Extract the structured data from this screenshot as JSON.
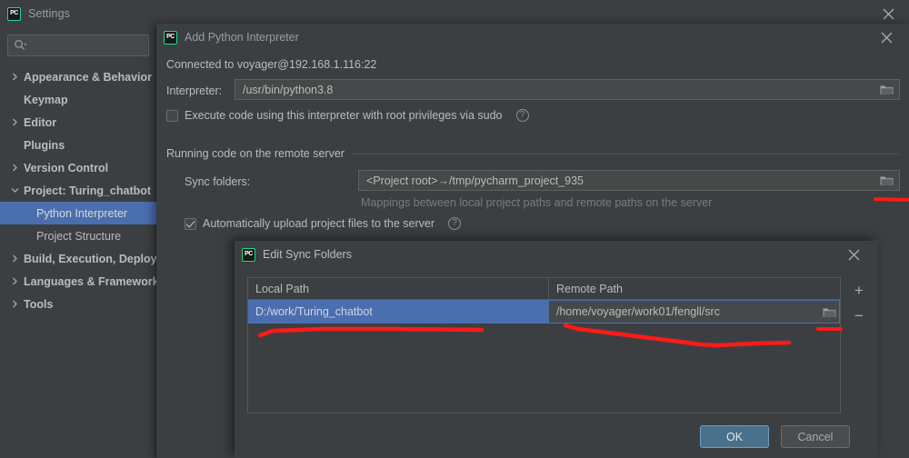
{
  "settings_window": {
    "title": "Settings",
    "logo": "pycharm-logo",
    "close_icon": "close-icon",
    "search": {
      "placeholder": "",
      "value": "",
      "icon": "search-icon"
    },
    "tree": [
      {
        "label": "Appearance & Behavior",
        "arrow": "chevron-right",
        "bold": true,
        "child": false,
        "selected": false
      },
      {
        "label": "Keymap",
        "arrow": "none",
        "bold": true,
        "child": false,
        "selected": false
      },
      {
        "label": "Editor",
        "arrow": "chevron-right",
        "bold": true,
        "child": false,
        "selected": false
      },
      {
        "label": "Plugins",
        "arrow": "none",
        "bold": true,
        "child": false,
        "selected": false
      },
      {
        "label": "Version Control",
        "arrow": "chevron-right",
        "bold": true,
        "child": false,
        "selected": false
      },
      {
        "label": "Project: Turing_chatbot",
        "arrow": "chevron-down",
        "bold": true,
        "child": false,
        "selected": false
      },
      {
        "label": "Python Interpreter",
        "arrow": "none",
        "bold": false,
        "child": true,
        "selected": true
      },
      {
        "label": "Project Structure",
        "arrow": "none",
        "bold": false,
        "child": true,
        "selected": false
      },
      {
        "label": "Build, Execution, Deployment",
        "arrow": "chevron-right",
        "bold": true,
        "child": false,
        "selected": false
      },
      {
        "label": "Languages & Frameworks",
        "arrow": "chevron-right",
        "bold": true,
        "child": false,
        "selected": false
      },
      {
        "label": "Tools",
        "arrow": "chevron-right",
        "bold": true,
        "child": false,
        "selected": false
      }
    ]
  },
  "add_interpreter_dialog": {
    "title": "Add Python Interpreter",
    "logo": "pycharm-logo",
    "close_icon": "close-icon",
    "connected_text": "Connected to voyager@192.168.1.116:22",
    "interpreter_label": "Interpreter:",
    "interpreter_value": "/usr/bin/python3.8",
    "interpreter_browse_icon": "folder-icon",
    "sudo_checkbox": {
      "label": "Execute code using this interpreter with root privileges via sudo",
      "checked": false
    },
    "sudo_help_icon": "help-icon",
    "group_title": "Running code on the remote server",
    "sync_label": "Sync folders:",
    "sync_value": "<Project root>→/tmp/pycharm_project_935",
    "sync_browse_icon": "folder-icon",
    "sync_hint": "Mappings between local project paths and remote paths on the server",
    "auto_upload_checkbox": {
      "label": "Automatically upload project files to the server",
      "checked": true
    },
    "auto_upload_help_icon": "help-icon"
  },
  "edit_sync_folders_dialog": {
    "title": "Edit Sync Folders",
    "logo": "pycharm-logo",
    "close_icon": "close-icon",
    "table": {
      "columns": [
        "Local Path",
        "Remote Path"
      ],
      "rows": [
        {
          "local": "D:/work/Turing_chatbot",
          "remote": "/home/voyager/work01/fengll/src",
          "selected": true,
          "remote_browse_icon": "folder-icon"
        }
      ]
    },
    "add_button": "+",
    "remove_button": "−",
    "ok_button": "OK",
    "cancel_button": "Cancel"
  },
  "annotations": {
    "color": "#ff1a1a",
    "marks": [
      "underline-local-path",
      "underline-remote-path",
      "underline-sync-browse"
    ]
  }
}
